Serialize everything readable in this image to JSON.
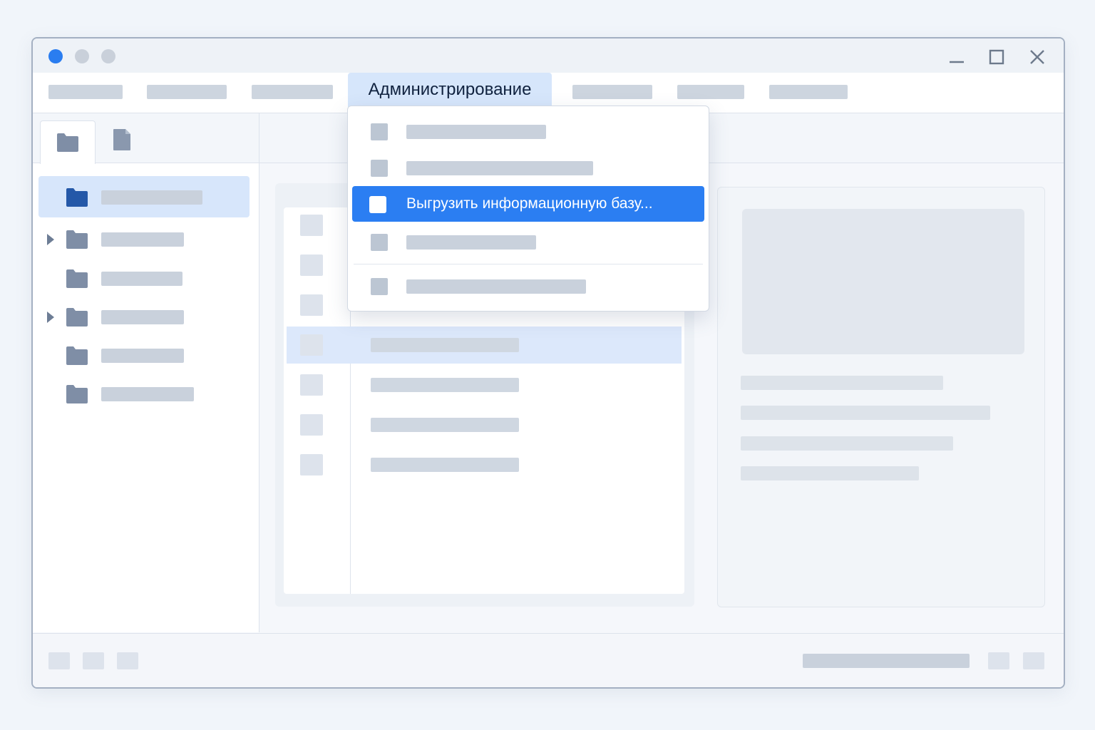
{
  "menubar": {
    "active_menu_label": "Администрирование"
  },
  "dropdown": {
    "highlighted_item_label": "Выгрузить информационную базу..."
  },
  "colors": {
    "accent": "#2b7ef2",
    "menu_active_bg": "#d6e6fb",
    "selection_bg": "#d7e6fb",
    "folder_icon": "#7f8ea6",
    "folder_icon_selected": "#2458a8"
  },
  "icons": [
    "folder-icon",
    "document-icon",
    "minimize-icon",
    "maximize-icon",
    "close-icon",
    "caret-right-icon"
  ]
}
